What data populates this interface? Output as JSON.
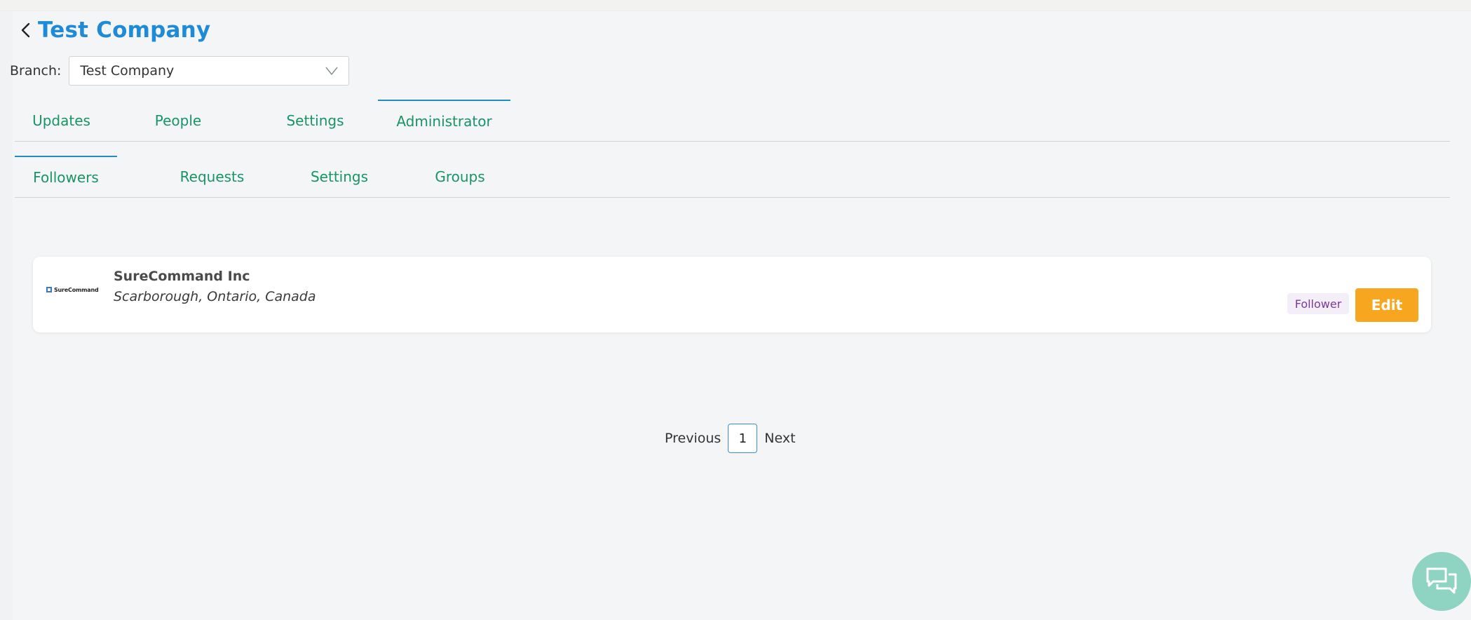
{
  "header": {
    "title": "Test Company"
  },
  "branch": {
    "label": "Branch:",
    "selected": "Test Company"
  },
  "primary_tabs": [
    {
      "label": "Updates",
      "active": false
    },
    {
      "label": "People",
      "active": false
    },
    {
      "label": "Settings",
      "active": false
    },
    {
      "label": "Administrator",
      "active": true
    }
  ],
  "secondary_tabs": [
    {
      "label": "Followers",
      "active": true
    },
    {
      "label": "Requests",
      "active": false
    },
    {
      "label": "Settings",
      "active": false
    },
    {
      "label": "Groups",
      "active": false
    }
  ],
  "followers": [
    {
      "logo_text": "SureCommand",
      "name": "SureCommand Inc",
      "location": "Scarborough, Ontario, Canada",
      "role": "Follower",
      "action_label": "Edit"
    }
  ],
  "pagination": {
    "previous_label": "Previous",
    "current_page": "1",
    "next_label": "Next"
  },
  "colors": {
    "title": "#1f8ad6",
    "tab_text": "#199466",
    "tab_active_line": "#1f8cc4",
    "edit_button": "#f6a61f",
    "badge_bg": "#f4eef8",
    "badge_text": "#7b3a9c",
    "chat_fab": "#8fd3c2"
  },
  "icons": {
    "back": "chevron-left-icon",
    "dropdown": "chevron-down-icon",
    "chat": "chat-bubbles-icon"
  }
}
